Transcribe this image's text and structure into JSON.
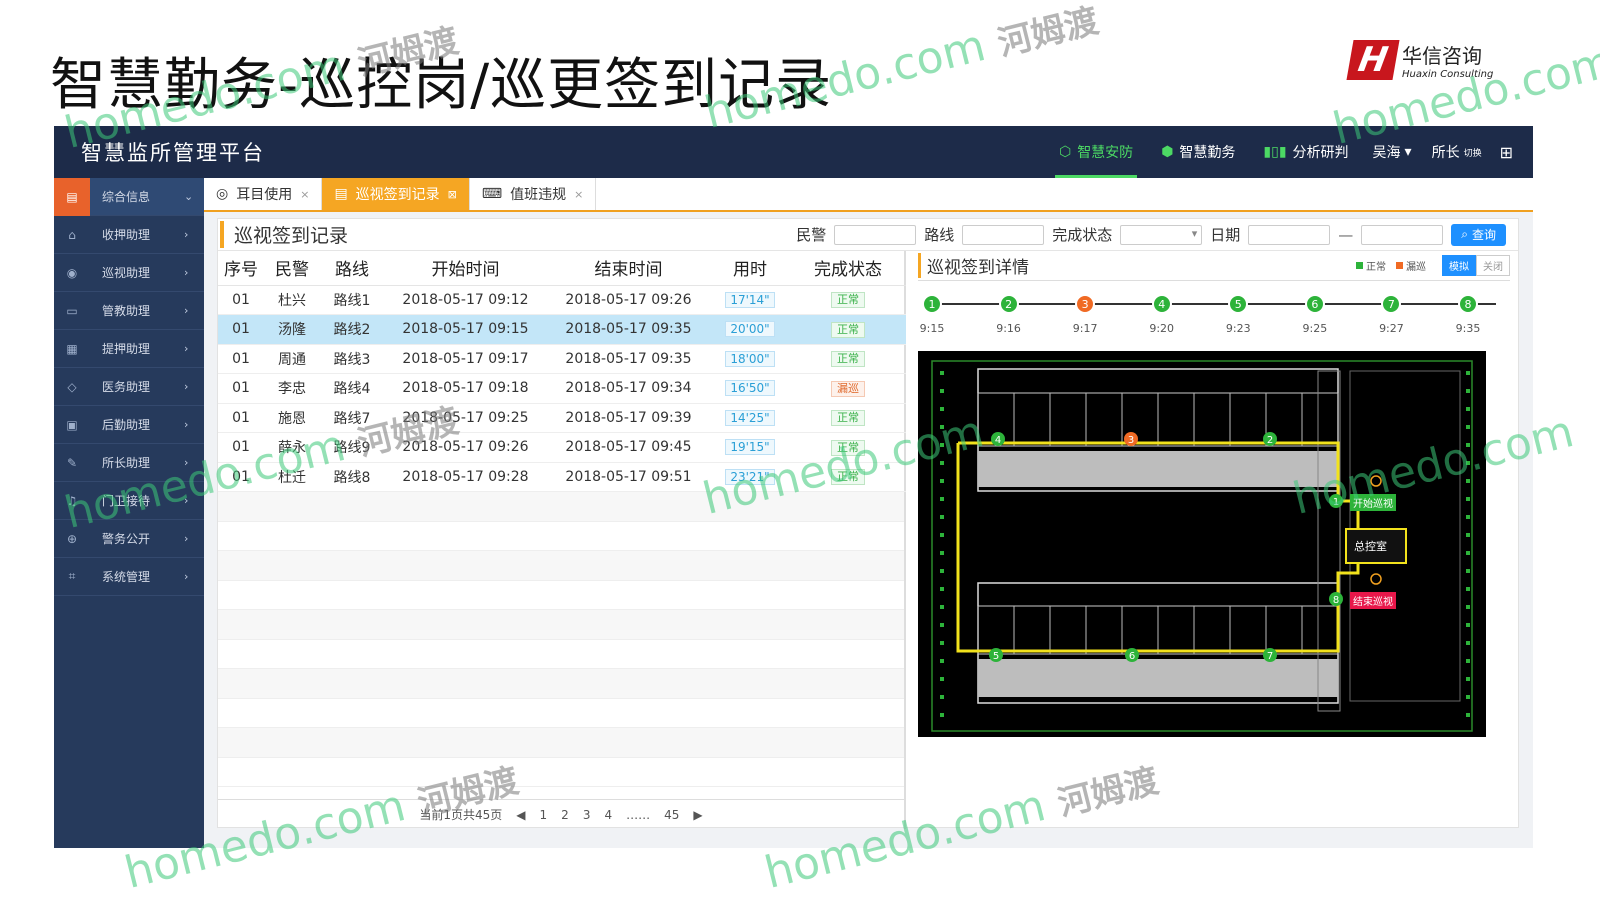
{
  "slide": {
    "title": "智慧勤务-巡控岗/巡更签到记录",
    "brand_cn": "华信咨询",
    "brand_en": "Huaxin Consulting",
    "brand_mark": "H"
  },
  "app": {
    "title": "智慧监所管理平台",
    "nav": [
      {
        "label": "智慧安防",
        "icon": "shield-icon"
      },
      {
        "label": "智慧勤务",
        "icon": "cube-icon"
      },
      {
        "label": "分析研判",
        "icon": "bar-chart-icon"
      }
    ],
    "user_name": "吴海",
    "role": "所长",
    "switch": "切换"
  },
  "sidebar": {
    "items": [
      {
        "label": "综合信息",
        "icon": "document-icon",
        "arrow": "⌄"
      },
      {
        "label": "收押助理",
        "icon": "house-icon",
        "arrow": "›"
      },
      {
        "label": "巡视助理",
        "icon": "camera-icon",
        "arrow": "›"
      },
      {
        "label": "管教助理",
        "icon": "card-icon",
        "arrow": "›"
      },
      {
        "label": "提押助理",
        "icon": "clipboard-icon",
        "arrow": "›"
      },
      {
        "label": "医务助理",
        "icon": "drop-icon",
        "arrow": "›"
      },
      {
        "label": "后勤助理",
        "icon": "briefcase-icon",
        "arrow": "›"
      },
      {
        "label": "所长助理",
        "icon": "pen-icon",
        "arrow": "›"
      },
      {
        "label": "门卫接待",
        "icon": "bell-icon",
        "arrow": "›"
      },
      {
        "label": "警务公开",
        "icon": "globe-icon",
        "arrow": "›"
      },
      {
        "label": "系统管理",
        "icon": "frame-icon",
        "arrow": "›"
      }
    ]
  },
  "tabs": [
    {
      "label": "耳目使用",
      "close": "×"
    },
    {
      "label": "巡视签到记录",
      "close": "⊠"
    },
    {
      "label": "值班违规",
      "close": "×"
    }
  ],
  "page": {
    "title": "巡视签到记录",
    "filters": {
      "police": "民警",
      "route": "路线",
      "status": "完成状态",
      "date": "日期",
      "query": "查询"
    }
  },
  "table": {
    "headers": [
      "序号",
      "民警",
      "路线",
      "开始时间",
      "结束时间",
      "用时",
      "完成状态"
    ],
    "rows": [
      {
        "no": "01",
        "officer": "杜兴",
        "route": "路线1",
        "start": "2018-05-17 09:12",
        "end": "2018-05-17 09:26",
        "duration": "17'14\"",
        "status": "正常"
      },
      {
        "no": "01",
        "officer": "汤隆",
        "route": "路线2",
        "start": "2018-05-17 09:15",
        "end": "2018-05-17 09:35",
        "duration": "20'00\"",
        "status": "正常"
      },
      {
        "no": "01",
        "officer": "周通",
        "route": "路线3",
        "start": "2018-05-17 09:17",
        "end": "2018-05-17 09:35",
        "duration": "18'00\"",
        "status": "正常"
      },
      {
        "no": "01",
        "officer": "李忠",
        "route": "路线4",
        "start": "2018-05-17 09:18",
        "end": "2018-05-17 09:34",
        "duration": "16'50\"",
        "status": "漏巡"
      },
      {
        "no": "01",
        "officer": "施恩",
        "route": "路线7",
        "start": "2018-05-17 09:25",
        "end": "2018-05-17 09:39",
        "duration": "14'25\"",
        "status": "正常"
      },
      {
        "no": "01",
        "officer": "薛永",
        "route": "路线9",
        "start": "2018-05-17 09:26",
        "end": "2018-05-17 09:45",
        "duration": "19'15\"",
        "status": "正常"
      },
      {
        "no": "01",
        "officer": "杜迁",
        "route": "路线8",
        "start": "2018-05-17 09:28",
        "end": "2018-05-17 09:51",
        "duration": "23'21\"",
        "status": "正常"
      }
    ]
  },
  "pager": {
    "summary": "当前1页共45页",
    "prev": "◀",
    "pages": [
      "1",
      "2",
      "3",
      "4"
    ],
    "ellipsis": "……",
    "last": "45",
    "next": "▶"
  },
  "detail": {
    "title": "巡视签到详情",
    "legend_normal": "正常",
    "legend_missed": "漏巡",
    "mode_simulate": "模拟",
    "mode_close": "关闭",
    "colors": {
      "normal": "#2db33a",
      "missed": "#f06a24"
    },
    "timeline": [
      {
        "n": "1",
        "time": "9:15",
        "state": "normal"
      },
      {
        "n": "2",
        "time": "9:16",
        "state": "normal"
      },
      {
        "n": "3",
        "time": "9:17",
        "state": "missed"
      },
      {
        "n": "4",
        "time": "9:20",
        "state": "normal"
      },
      {
        "n": "5",
        "time": "9:23",
        "state": "normal"
      },
      {
        "n": "6",
        "time": "9:25",
        "state": "normal"
      },
      {
        "n": "7",
        "time": "9:27",
        "state": "normal"
      },
      {
        "n": "8",
        "time": "9:35",
        "state": "normal"
      }
    ],
    "plan": {
      "start_label": "开始巡视",
      "end_label": "结束巡视",
      "control_room": "总控室"
    }
  },
  "watermark": {
    "latin": "homedo.com",
    "cn": "河姆渡"
  }
}
